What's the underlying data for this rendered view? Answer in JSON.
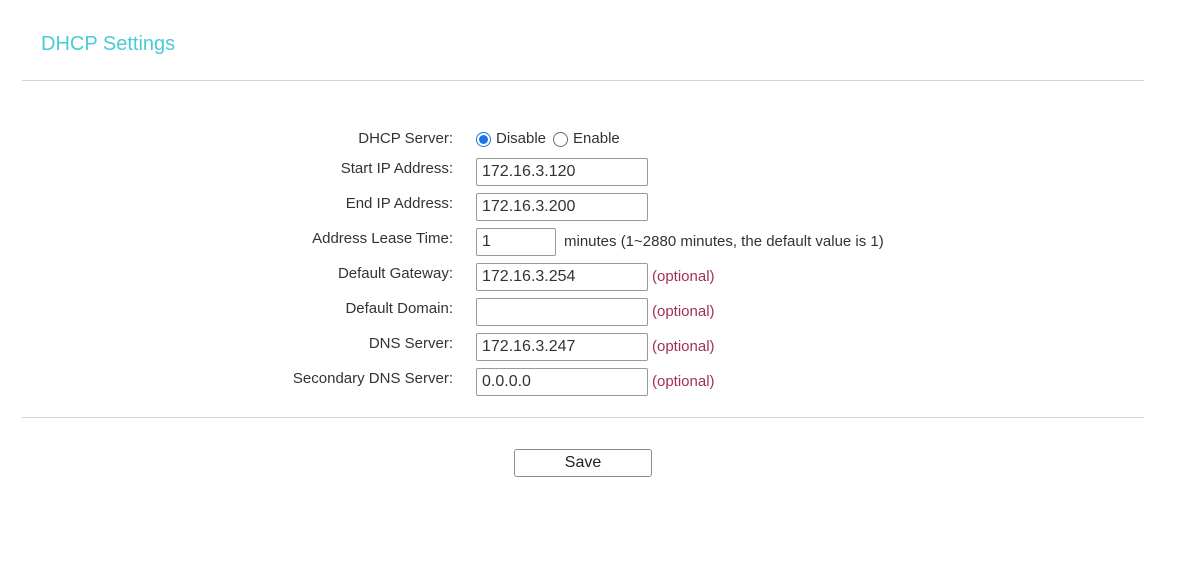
{
  "header": {
    "title": "DHCP Settings"
  },
  "form": {
    "dhcp_server": {
      "label": "DHCP Server:",
      "options": [
        {
          "label": "Disable",
          "selected": true
        },
        {
          "label": "Enable",
          "selected": false
        }
      ]
    },
    "start_ip": {
      "label": "Start IP Address:",
      "value": "172.16.3.120"
    },
    "end_ip": {
      "label": "End IP Address:",
      "value": "172.16.3.200"
    },
    "lease_time": {
      "label": "Address Lease Time:",
      "value": "1",
      "hint": "minutes (1~2880 minutes, the default value is 1)"
    },
    "default_gateway": {
      "label": "Default Gateway:",
      "value": "172.16.3.254",
      "note": "(optional)"
    },
    "default_domain": {
      "label": "Default Domain:",
      "value": "",
      "note": "(optional)"
    },
    "dns_server": {
      "label": "DNS Server:",
      "value": "172.16.3.247",
      "note": "(optional)"
    },
    "secondary_dns": {
      "label": "Secondary DNS Server:",
      "value": "0.0.0.0",
      "note": "(optional)"
    }
  },
  "actions": {
    "save_label": "Save"
  },
  "colors": {
    "title": "#4acbd6",
    "optional": "#a0305a",
    "radio_accent": "#1a73e8"
  }
}
